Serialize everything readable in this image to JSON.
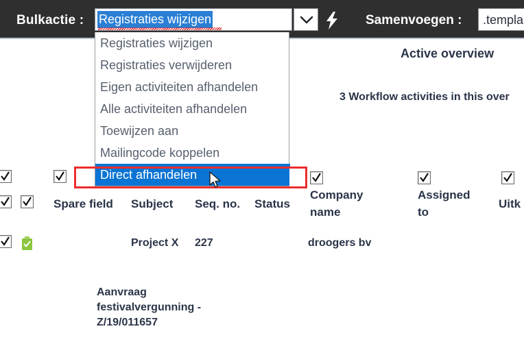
{
  "topbar": {
    "bulk_label": "Bulkactie :",
    "merge_label": "Samenvoegen :",
    "bulk_selected_value": "Registraties wijzigen",
    "merge_value": ".templa",
    "bolt_icon": "lightning-bolt-icon",
    "chevron_icon": "chevron-down-icon"
  },
  "dropdown": {
    "items": [
      {
        "label": "Registraties wijzigen",
        "selected": false
      },
      {
        "label": "Registraties verwijderen",
        "selected": false
      },
      {
        "label": "Eigen activiteiten afhandelen",
        "selected": false
      },
      {
        "label": "Alle activiteiten afhandelen",
        "selected": false
      },
      {
        "label": "Toewijzen aan",
        "selected": false
      },
      {
        "label": "Mailingcode koppelen",
        "selected": false
      },
      {
        "label": "Direct afhandelen",
        "selected": true
      }
    ],
    "highlight_color": "#ec2d2d",
    "selection_color": "#0a74d4"
  },
  "overview": {
    "title": "Active overview",
    "workflow_count_text": "3 Workflow activities in this over"
  },
  "table": {
    "columns": [
      {
        "label": "Spare field",
        "checked": true
      },
      {
        "label": "Subject",
        "checked": true
      },
      {
        "label": "Seq. no.",
        "checked": true
      },
      {
        "label": "Status",
        "checked": true
      },
      {
        "label": "Company name",
        "checked": true
      },
      {
        "label": "Assigned to",
        "checked": true
      },
      {
        "label": "Uitk",
        "checked": true
      }
    ],
    "rows": [
      {
        "status_icon": "clipboard-check-icon",
        "row_checked": true,
        "spare_field": "",
        "subject": "Project X",
        "seq_no": "227",
        "status": "",
        "company_name": "droogers bv",
        "assigned_to": "",
        "uitk": ""
      }
    ],
    "detail_lines": [
      "Aanvraag",
      "festivalvergunning -",
      " Z/19/011657"
    ]
  },
  "cursor": {
    "icon": "mouse-pointer-icon"
  }
}
